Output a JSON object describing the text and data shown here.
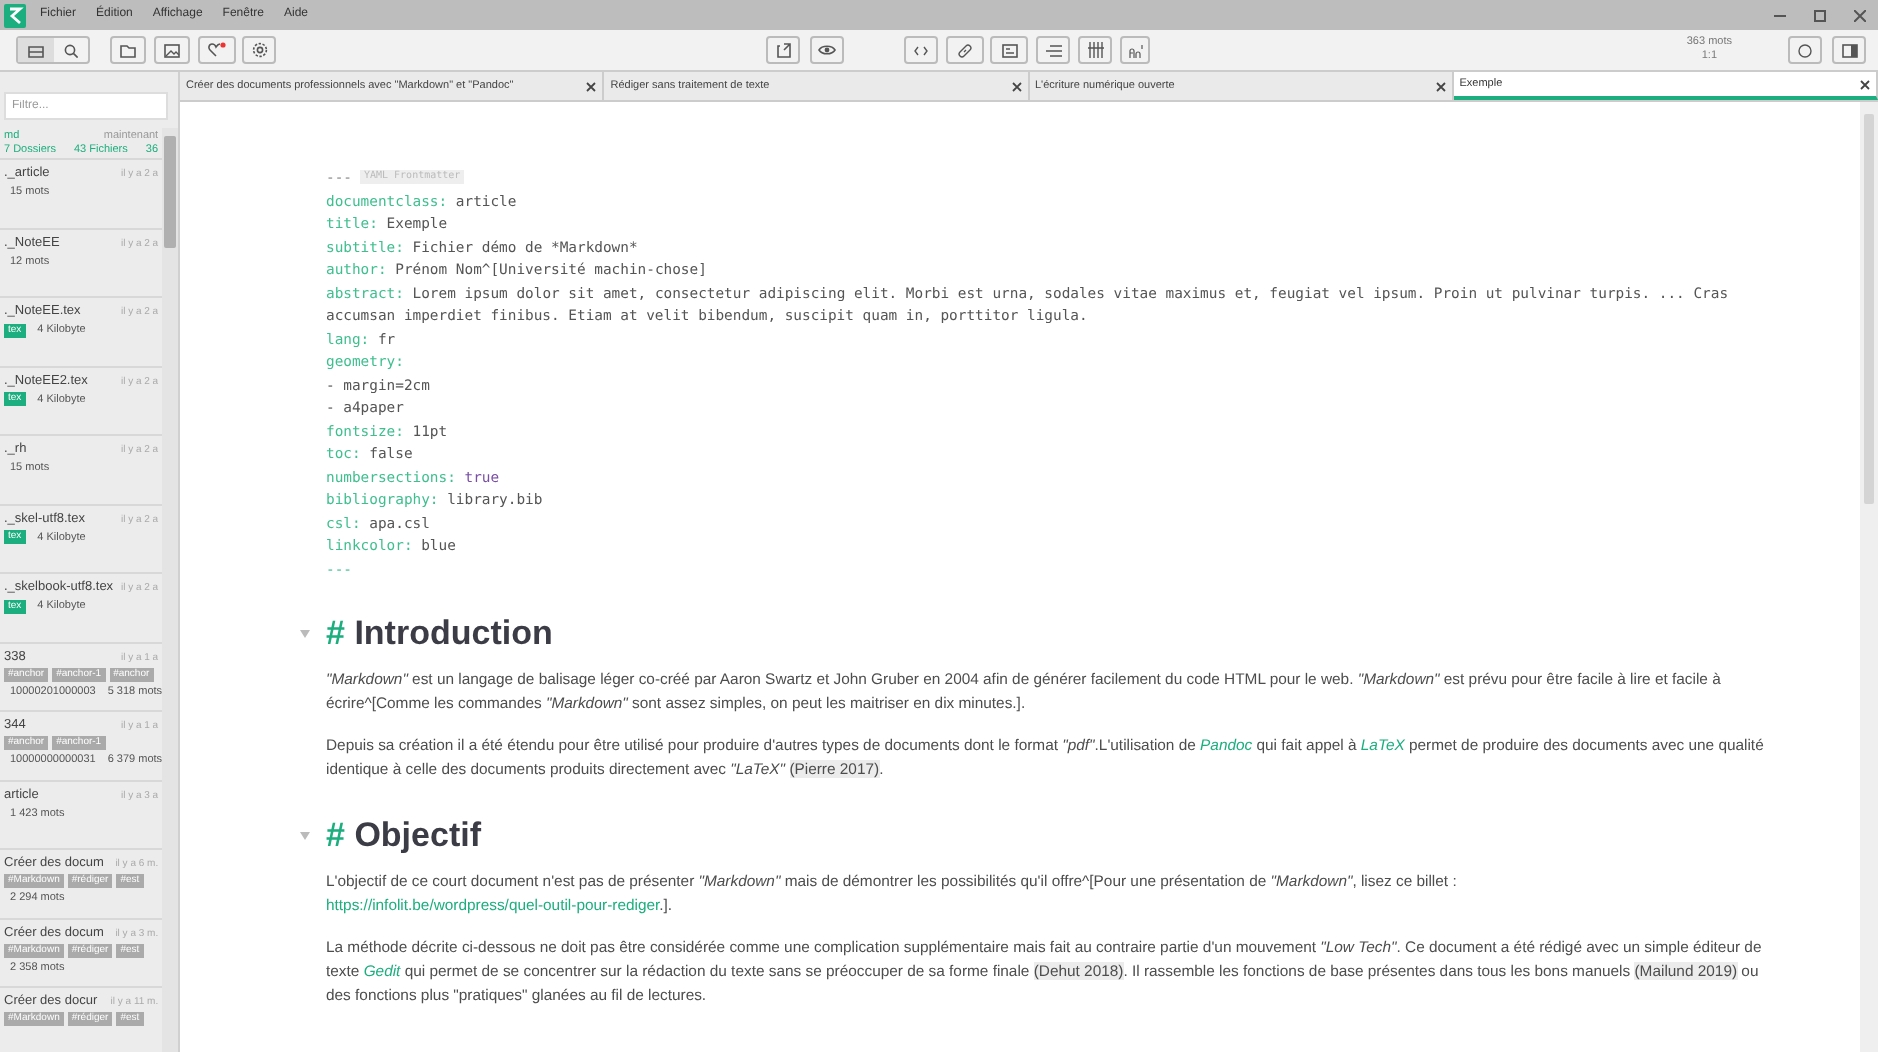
{
  "menu": [
    "Fichier",
    "Édition",
    "Affichage",
    "Fenêtre",
    "Aide"
  ],
  "toolbar": {
    "word_count": "363 mots",
    "cursor": "1:1"
  },
  "sidebar": {
    "filter_placeholder": "Filtre...",
    "directory": {
      "name": "md",
      "modified": "maintenant",
      "folders": "7 Dossiers",
      "files": "43 Fichiers",
      "count": "36"
    },
    "files": [
      {
        "name": "._article",
        "time": "il y a 2 a",
        "kind": "md",
        "meta": [
          "15 mots"
        ]
      },
      {
        "name": "._NoteEE",
        "time": "il y a 2 a",
        "kind": "md",
        "meta": [
          "12 mots"
        ]
      },
      {
        "name": "._NoteEE.tex",
        "time": "il y a 2 a",
        "kind": "tex",
        "badge": "tex",
        "meta": [
          "4 Kilobyte"
        ]
      },
      {
        "name": "._NoteEE2.tex",
        "time": "il y a 2 a",
        "kind": "tex",
        "badge": "tex",
        "meta": [
          "4 Kilobyte"
        ]
      },
      {
        "name": "._rh",
        "time": "il y a 2 a",
        "kind": "md",
        "meta": [
          "15 mots"
        ]
      },
      {
        "name": "._skel-utf8.tex",
        "time": "il y a 2 a",
        "kind": "tex",
        "badge": "tex",
        "meta": [
          "4 Kilobyte"
        ]
      },
      {
        "name": "._skelbook-utf8.tex",
        "time": "il y a 2 a",
        "kind": "tex",
        "badge": "tex",
        "meta": [
          "4 Kilobyte"
        ]
      },
      {
        "name": "338",
        "time": "il y a 1 a",
        "kind": "md",
        "tags": [
          "#anchor",
          "#anchor-1",
          "#anchor"
        ],
        "meta": [
          "10000201000003",
          "5 318 mots"
        ]
      },
      {
        "name": "344",
        "time": "il y a 1 a",
        "kind": "md",
        "tags": [
          "#anchor",
          "#anchor-1"
        ],
        "meta": [
          "10000000000031",
          "6 379 mots"
        ]
      },
      {
        "name": "article",
        "time": "il y a 3 a",
        "kind": "md",
        "meta": [
          "1 423 mots"
        ]
      },
      {
        "name": "Créer des docum",
        "time": "il y a 6 m.",
        "kind": "md",
        "tags": [
          "#Markdown",
          "#rédiger",
          "#est"
        ],
        "meta": [
          "2 294 mots"
        ]
      },
      {
        "name": "Créer des docum",
        "time": "il y a 3 m.",
        "kind": "md",
        "tags": [
          "#Markdown",
          "#rédiger",
          "#est"
        ],
        "meta": [
          "2 358 mots"
        ]
      },
      {
        "name": "Créer des docur",
        "time": "il y a 11 m.",
        "kind": "md",
        "tags": [
          "#Markdown",
          "#rédiger",
          "#est"
        ]
      }
    ]
  },
  "tabs": [
    {
      "label": "Créer des documents professionnels avec \"Markdown\" et \"Pandoc\"",
      "selected": false
    },
    {
      "label": "Rédiger sans traitement de texte",
      "selected": false
    },
    {
      "label": "L'écriture numérique ouverte",
      "selected": false
    },
    {
      "label": "Exemple",
      "selected": true
    }
  ],
  "editor": {
    "frontmatter": {
      "open": "---",
      "badge": "YAML Frontmatter",
      "close": "---",
      "lines": [
        {
          "kind": "pair",
          "key": "documentclass:",
          "value": "article"
        },
        {
          "kind": "pair",
          "key": "title:",
          "value": "Exemple"
        },
        {
          "kind": "pair",
          "key": "subtitle:",
          "value": "Fichier démo de *Markdown*"
        },
        {
          "kind": "pair",
          "key": "author:",
          "value": "Prénom Nom^[Université machin-chose]"
        },
        {
          "kind": "pair",
          "key": "abstract:",
          "value": "Lorem ipsum dolor sit amet, consectetur adipiscing elit. Morbi est urna, sodales vitae maximus et, feugiat vel ipsum. Proin ut pulvinar turpis. ... Cras accumsan imperdiet finibus. Etiam at velit bibendum, suscipit quam in, porttitor ligula."
        },
        {
          "kind": "pair",
          "key": "lang:",
          "value": "fr"
        },
        {
          "kind": "pair",
          "key": "geometry:"
        },
        {
          "kind": "item",
          "text": "- margin=2cm"
        },
        {
          "kind": "item",
          "text": "- a4paper"
        },
        {
          "kind": "pair",
          "key": "fontsize:",
          "value": "11pt"
        },
        {
          "kind": "pair",
          "key": "toc:",
          "value": "false"
        },
        {
          "kind": "bool-pair",
          "key": "numbersections:",
          "value": "true"
        },
        {
          "kind": "pair",
          "key": "bibliography:",
          "value": "library.bib"
        },
        {
          "kind": "pair",
          "key": "csl:",
          "value": "apa.csl"
        },
        {
          "kind": "pair",
          "key": "linkcolor:",
          "value": "blue"
        }
      ]
    },
    "blocks": [
      {
        "kind": "heading",
        "marker": "#",
        "text": "Introduction"
      },
      {
        "kind": "paragraph",
        "segments": [
          {
            "kind": "em",
            "text": "\"Markdown\""
          },
          {
            "kind": "text",
            "text": " est un langage de balisage léger co-créé par Aaron Swartz et John Gruber en 2004 afin de générer facilement du code HTML pour le web. "
          },
          {
            "kind": "em",
            "text": "\"Markdown\""
          },
          {
            "kind": "text",
            "text": " est prévu pour être facile à lire et facile à écrire^[Comme les commandes "
          },
          {
            "kind": "em",
            "text": "\"Markdown\""
          },
          {
            "kind": "text",
            "text": " sont assez simples, on peut les maitriser en dix minutes.]."
          }
        ]
      },
      {
        "kind": "paragraph",
        "segments": [
          {
            "kind": "text",
            "text": "Depuis sa création il a été étendu pour être utilisé pour produire d'autres types de documents dont le format "
          },
          {
            "kind": "em",
            "text": "\"pdf\""
          },
          {
            "kind": "text",
            "text": ".L'utilisation de "
          },
          {
            "kind": "accent",
            "text": "Pandoc"
          },
          {
            "kind": "text",
            "text": " qui fait appel à "
          },
          {
            "kind": "accent",
            "text": "LaTeX"
          },
          {
            "kind": "text",
            "text": " permet de produire des documents avec une qualité identique à celle des documents produits directement avec "
          },
          {
            "kind": "em",
            "text": "\"LaTeX\" "
          },
          {
            "kind": "cite",
            "text": "(Pierre 2017)"
          },
          {
            "kind": "text",
            "text": "."
          }
        ]
      },
      {
        "kind": "heading",
        "marker": "#",
        "text": "Objectif"
      },
      {
        "kind": "paragraph",
        "segments": [
          {
            "kind": "text",
            "text": "L'objectif de ce court document n'est pas de présenter "
          },
          {
            "kind": "em",
            "text": "\"Markdown\""
          },
          {
            "kind": "text",
            "text": " mais de démontrer les possibilités qu'il offre^[Pour une présentation de "
          },
          {
            "kind": "em",
            "text": "\"Markdown\""
          },
          {
            "kind": "text",
            "text": ", lisez ce billet : "
          },
          {
            "kind": "link",
            "text": "https://infolit.be/wordpress/quel-outil-pour-rediger"
          },
          {
            "kind": "text",
            "text": ".]."
          }
        ]
      },
      {
        "kind": "paragraph",
        "segments": [
          {
            "kind": "text",
            "text": "La méthode décrite ci-dessous ne doit pas être considérée comme une complication supplémentaire mais fait au contraire partie d'un mouvement "
          },
          {
            "kind": "em",
            "text": "\"Low Tech\""
          },
          {
            "kind": "text",
            "text": ". Ce document a été rédigé avec un simple éditeur de texte "
          },
          {
            "kind": "accent",
            "text": "Gedit"
          },
          {
            "kind": "text",
            "text": " qui permet de se concentrer sur la rédaction du texte sans se préoccuper de sa forme finale "
          },
          {
            "kind": "cite",
            "text": "(Dehut 2018)"
          },
          {
            "kind": "text",
            "text": ". Il rassemble les fonctions de base présentes dans tous les bons manuels "
          },
          {
            "kind": "cite",
            "text": "(Mailund 2019)"
          },
          {
            "kind": "text",
            "text": " ou des fonctions plus \"pratiques\" glanées au fil de lectures."
          }
        ]
      }
    ]
  }
}
